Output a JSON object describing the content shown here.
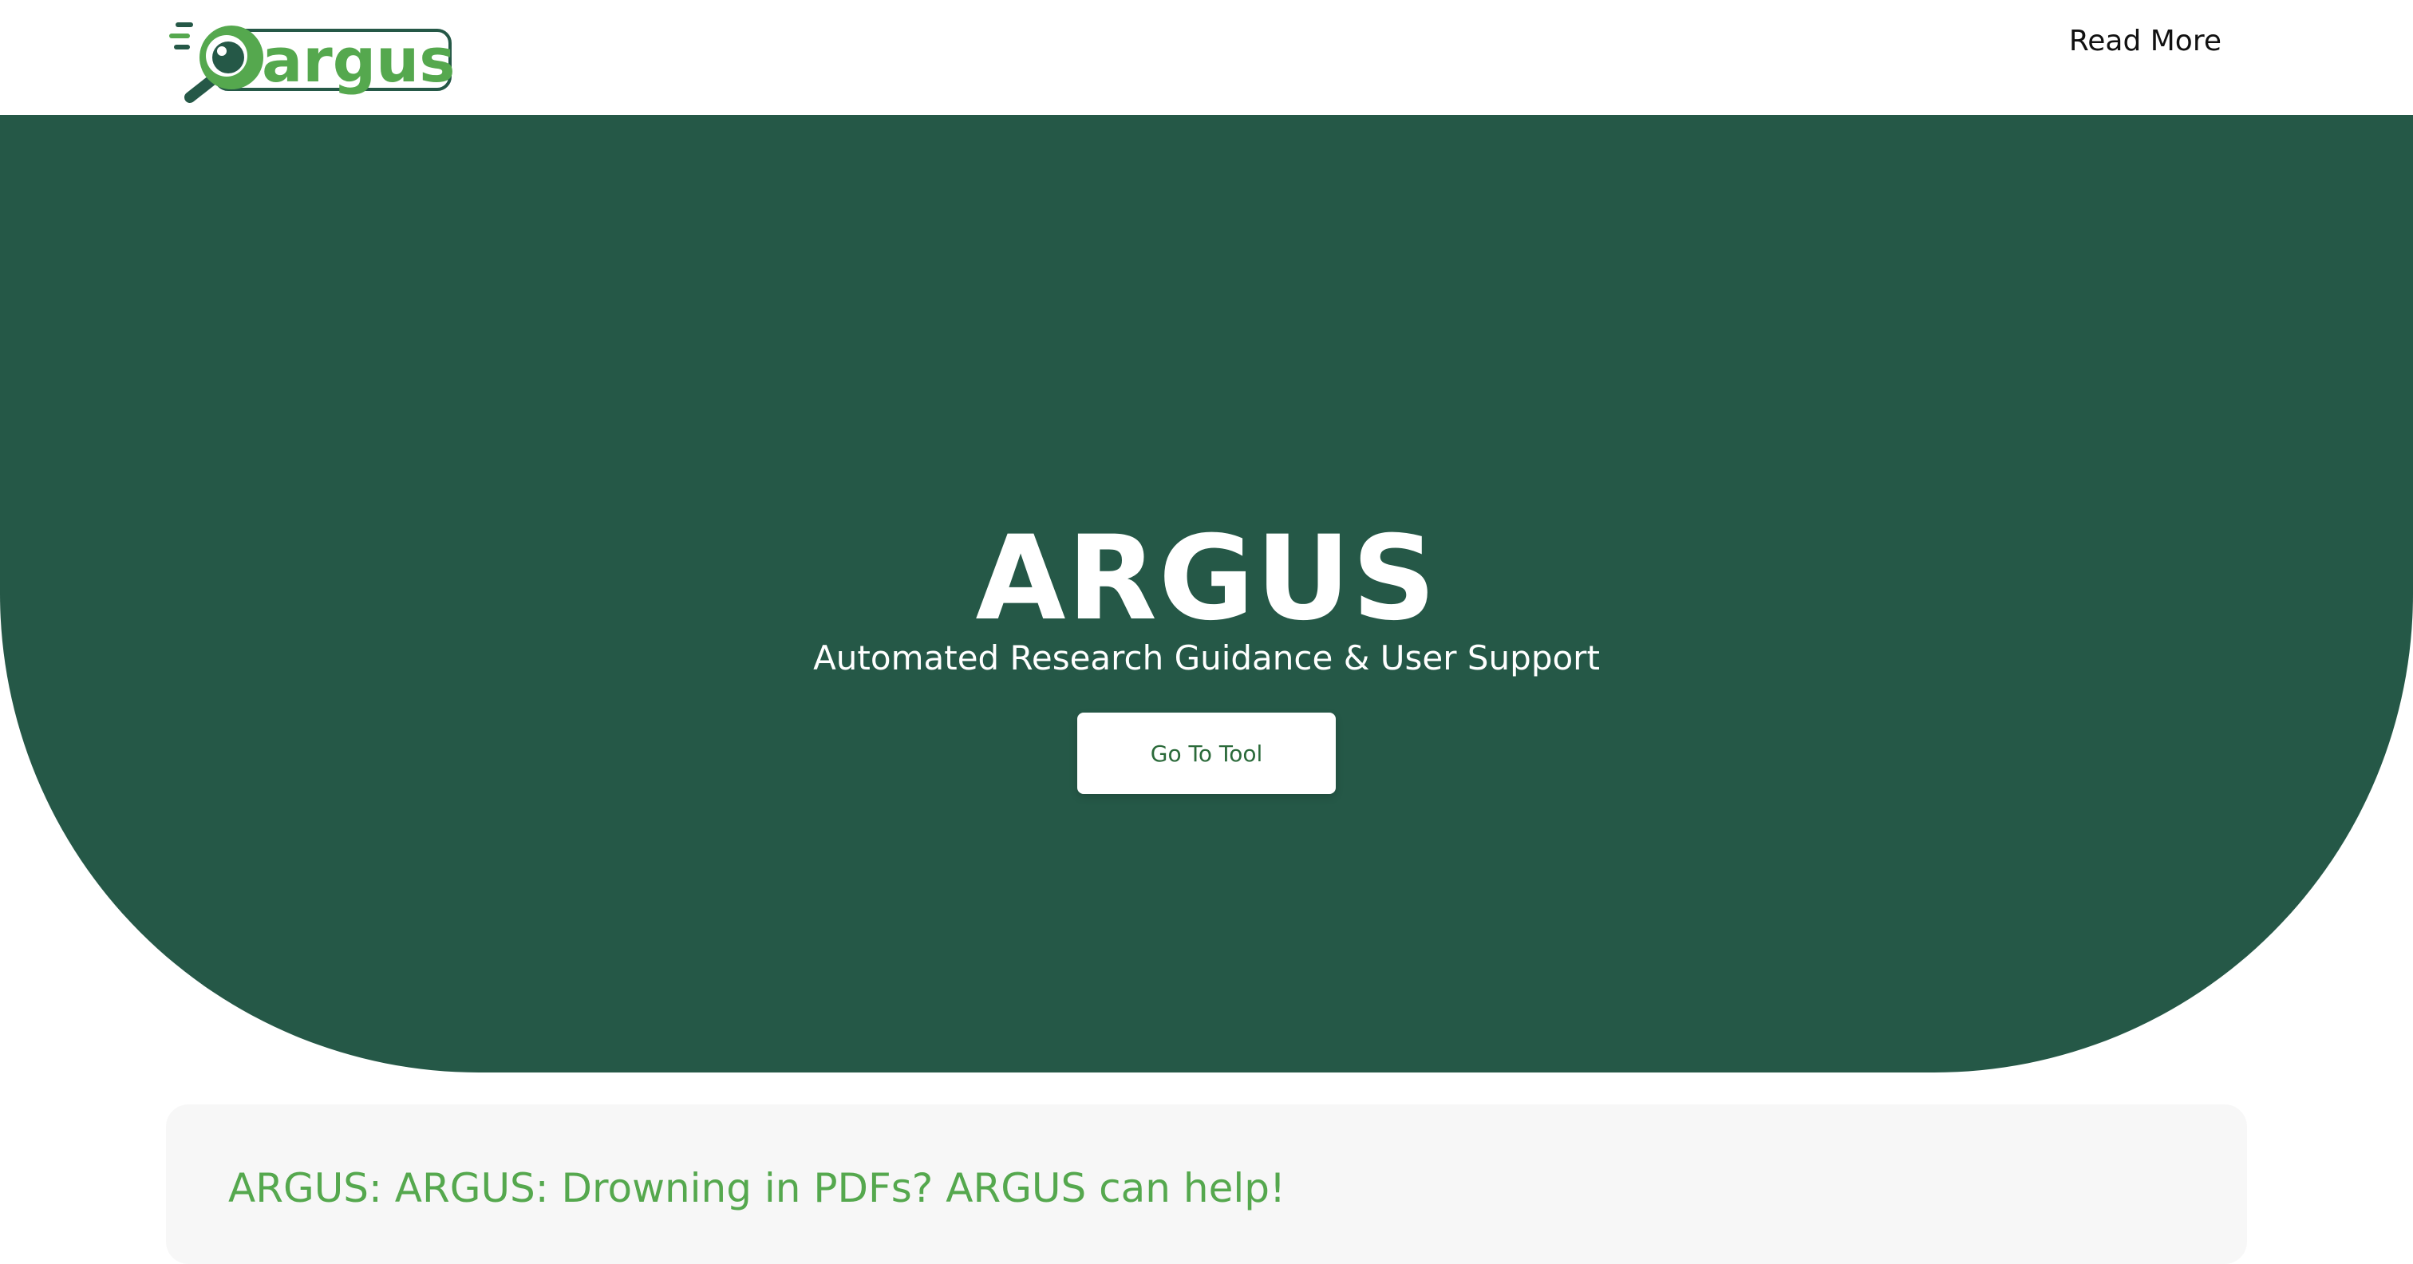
{
  "nav": {
    "logo_text": "argus",
    "read_more_label": "Read More"
  },
  "hero": {
    "title": "ARGUS",
    "subtitle": "Automated Research Guidance & User Support",
    "button_label": "Go To Tool",
    "background_color": "#255847"
  },
  "card": {
    "title": "ARGUS: ARGUS: Drowning in PDFs? ARGUS can help!",
    "title_color": "#55a84e"
  },
  "colors": {
    "brand_dark": "#255847",
    "brand_light": "#55a84e"
  }
}
